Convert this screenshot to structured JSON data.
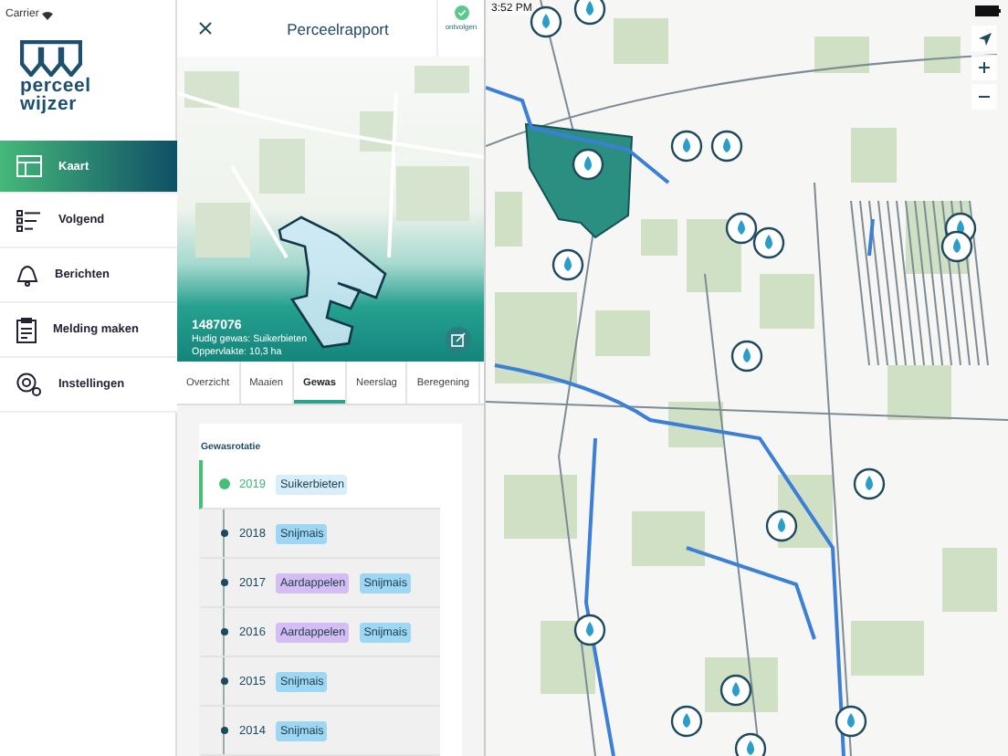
{
  "status_bar": {
    "carrier": "Carrier",
    "time": "3:52 PM"
  },
  "sidebar": {
    "logo": [
      "perceel",
      "wijzer"
    ],
    "items": [
      {
        "label": "Kaart",
        "kind": "map",
        "selected": true
      },
      {
        "label": "Volgend",
        "kind": "list",
        "selected": false
      },
      {
        "label": "Berichten",
        "kind": "bell",
        "selected": false
      },
      {
        "label": "Melding maken",
        "kind": "clipboard",
        "selected": false
      },
      {
        "label": "Instellingen",
        "kind": "gear",
        "selected": false
      }
    ]
  },
  "panel": {
    "title": "Perceelrapport",
    "follow_button": "ontvolgen",
    "parcel_id": "1487076",
    "details": [
      "Hudig gewas: Suikerbieten",
      "Oppervlakte: 10,3 ha"
    ],
    "tabs": [
      {
        "label": "Overzicht",
        "selected": false
      },
      {
        "label": "Maaien",
        "selected": false
      },
      {
        "label": "Gewas",
        "selected": true
      },
      {
        "label": "Neerslag",
        "selected": false
      },
      {
        "label": "Beregening",
        "selected": false
      }
    ],
    "section_title": "Gewasrotatie",
    "rotation": [
      {
        "year": "2019",
        "selected": true,
        "crops": [
          {
            "name": "Suikerbieten",
            "color": "#d8eefb"
          }
        ]
      },
      {
        "year": "2018",
        "selected": false,
        "crops": [
          {
            "name": "Snijmais",
            "color": "#9ed7f3"
          }
        ]
      },
      {
        "year": "2017",
        "selected": false,
        "crops": [
          {
            "name": "Aardappelen",
            "color": "#d4bdf2"
          },
          {
            "name": "Snijmais",
            "color": "#9ed7f3"
          }
        ]
      },
      {
        "year": "2016",
        "selected": false,
        "crops": [
          {
            "name": "Aardappelen",
            "color": "#d4bdf2"
          },
          {
            "name": "Snijmais",
            "color": "#9ed7f3"
          }
        ]
      },
      {
        "year": "2015",
        "selected": false,
        "crops": [
          {
            "name": "Snijmais",
            "color": "#9ed7f3"
          }
        ]
      },
      {
        "year": "2014",
        "selected": false,
        "crops": [
          {
            "name": "Snijmais",
            "color": "#9ed7f3"
          }
        ]
      }
    ]
  },
  "map_controls": [
    {
      "kind": "locate"
    },
    {
      "kind": "zoom_in"
    },
    {
      "kind": "zoom_out"
    }
  ]
}
